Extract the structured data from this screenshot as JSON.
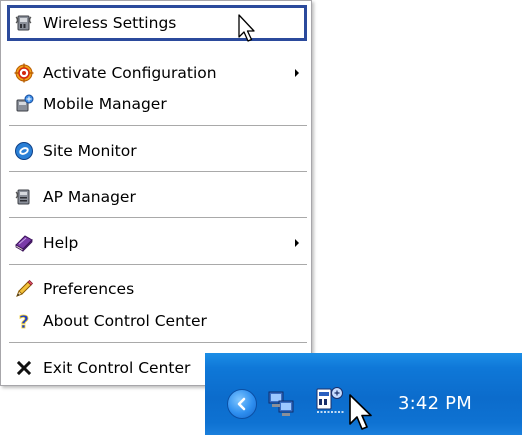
{
  "menu": {
    "items": [
      {
        "label": "Wireless Settings",
        "icon": "wireless-settings-icon",
        "has_submenu": false,
        "highlighted": true
      },
      {
        "label": "Activate Configuration",
        "icon": "target-icon",
        "has_submenu": true,
        "highlighted": false
      },
      {
        "label": "Mobile Manager",
        "icon": "mobile-manager-icon",
        "has_submenu": false,
        "highlighted": false
      },
      {
        "label": "Site Monitor",
        "icon": "site-monitor-icon",
        "has_submenu": false,
        "highlighted": false
      },
      {
        "label": "AP Manager",
        "icon": "ap-manager-icon",
        "has_submenu": false,
        "highlighted": false
      },
      {
        "label": "Help",
        "icon": "help-book-icon",
        "has_submenu": true,
        "highlighted": false
      },
      {
        "label": "Preferences",
        "icon": "pencil-icon",
        "has_submenu": false,
        "highlighted": false
      },
      {
        "label": "About Control Center",
        "icon": "question-mark-icon",
        "has_submenu": false,
        "highlighted": false
      },
      {
        "label": "Exit Control Center",
        "icon": "close-x-icon",
        "has_submenu": false,
        "highlighted": false
      }
    ]
  },
  "taskbar": {
    "clock": "3:42 PM",
    "colors": {
      "taskbar_blue": "#0f78d8",
      "highlight_border": "#2b4a9c"
    }
  }
}
